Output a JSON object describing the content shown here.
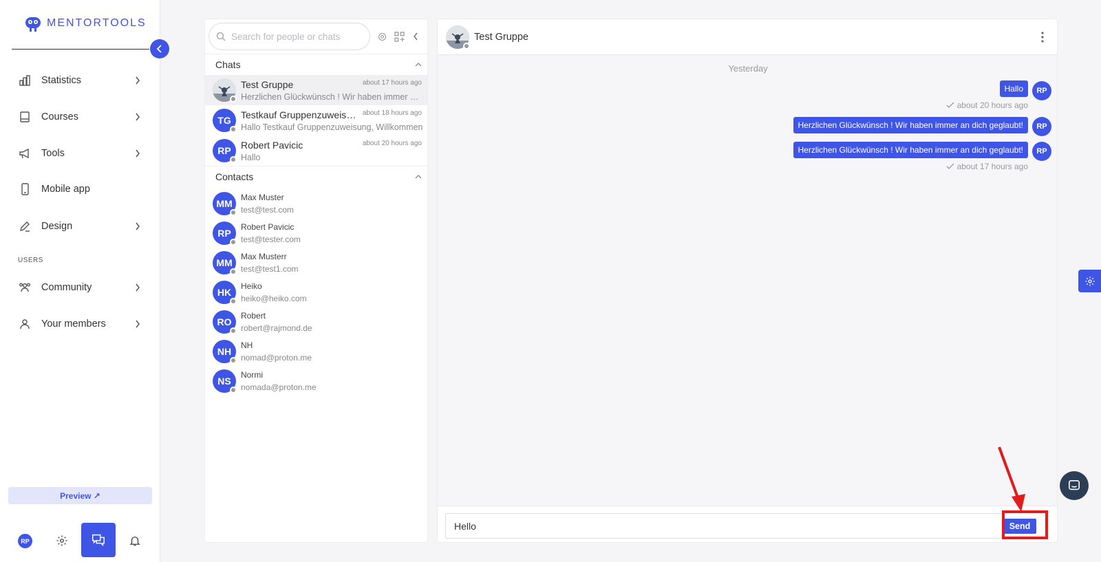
{
  "brand": {
    "name": "MENTORTOOLS"
  },
  "sidebar": {
    "items": [
      {
        "label": "Statistics",
        "icon": "bar-chart-icon"
      },
      {
        "label": "Courses",
        "icon": "book-icon"
      },
      {
        "label": "Tools",
        "icon": "megaphone-icon"
      },
      {
        "label": "Mobile app",
        "icon": "mobile-icon"
      },
      {
        "label": "Design",
        "icon": "pencil-icon"
      }
    ],
    "section_users": "USERS",
    "user_items": [
      {
        "label": "Community",
        "icon": "community-icon"
      },
      {
        "label": "Your members",
        "icon": "user-icon"
      }
    ],
    "preview_label": "Preview ↗",
    "user_initials": "RP"
  },
  "chat_list": {
    "search_placeholder": "Search for people or chats",
    "chats_header": "Chats",
    "contacts_header": "Contacts",
    "chats": [
      {
        "name": "Test Gruppe",
        "time": "about 17 hours ago",
        "preview": "Herzlichen Glückwünsch ! Wir haben immer an dich geglaubt!",
        "initials": ""
      },
      {
        "name": "Testkauf Gruppenzuweisung",
        "time": "about 18 hours ago",
        "preview": "Hallo Testkauf Gruppenzuweisung, Willkommen",
        "initials": "TG"
      },
      {
        "name": "Robert Pavicic",
        "time": "about 20 hours ago",
        "preview": "Hallo",
        "initials": "RP"
      }
    ],
    "contacts": [
      {
        "name": "Max Muster",
        "email": "test@test.com",
        "initials": "MM"
      },
      {
        "name": "Robert Pavicic",
        "email": "test@tester.com",
        "initials": "RP"
      },
      {
        "name": "Max Musterr",
        "email": "test@test1.com",
        "initials": "MM"
      },
      {
        "name": "Heiko",
        "email": "heiko@heiko.com",
        "initials": "HK"
      },
      {
        "name": "Robert",
        "email": "robert@rajmond.de",
        "initials": "RO"
      },
      {
        "name": "NH",
        "email": "nomad@proton.me",
        "initials": "NH"
      },
      {
        "name": "Normi",
        "email": "nomada@proton.me",
        "initials": "NS"
      }
    ]
  },
  "conversation": {
    "title": "Test Gruppe",
    "day_separator": "Yesterday",
    "messages": [
      {
        "text": "Hallo",
        "avatar": "RP",
        "meta": "about 20 hours ago"
      },
      {
        "text": "Herzlichen Glückwünsch ! Wir haben immer an dich geglaubt!",
        "avatar": "RP",
        "meta": ""
      },
      {
        "text": "Herzlichen Glückwünsch ! Wir haben immer an dich geglaubt!",
        "avatar": "RP",
        "meta": "about 17 hours ago"
      }
    ],
    "composer_value": "Hello",
    "send_label": "Send"
  },
  "colors": {
    "accent": "#3f55e6",
    "annotation": "#e21b1b"
  }
}
